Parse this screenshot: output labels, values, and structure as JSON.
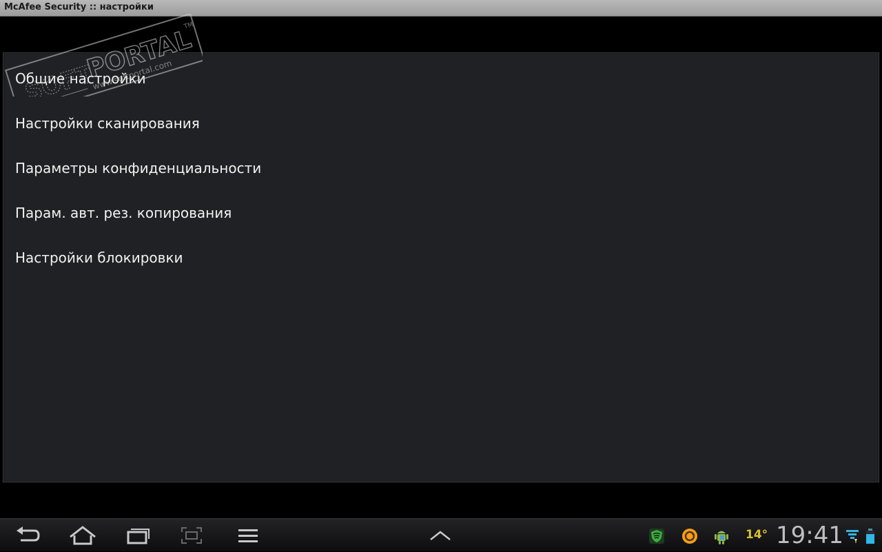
{
  "window": {
    "title": "McAfee Security :: настройки"
  },
  "watermark": {
    "brand": "PORTAL",
    "prefix": "SOFT",
    "site": "www.softportal.com",
    "tm": "TM"
  },
  "menu": {
    "items": [
      {
        "label": "Общие настройки"
      },
      {
        "label": "Настройки сканирования"
      },
      {
        "label": "Параметры конфиденциальности"
      },
      {
        "label": "Парам. авт. рез. копирования"
      },
      {
        "label": "Настройки блокировки"
      }
    ]
  },
  "navbar": {
    "buttons": [
      "back-icon",
      "home-icon",
      "recent-apps-icon",
      "screenshot-icon",
      "menu-icon",
      "chevron-up-icon"
    ]
  },
  "status": {
    "temperature": "14°",
    "clock": "19:41",
    "icons": [
      "shield-icon",
      "sync-icon",
      "android-icon",
      "wifi-icon",
      "battery-icon"
    ],
    "colors": {
      "temperature": "#d8c230",
      "wifi": "#33b5e5",
      "shield": "#3fae3f",
      "sync": "#f0a020"
    }
  }
}
